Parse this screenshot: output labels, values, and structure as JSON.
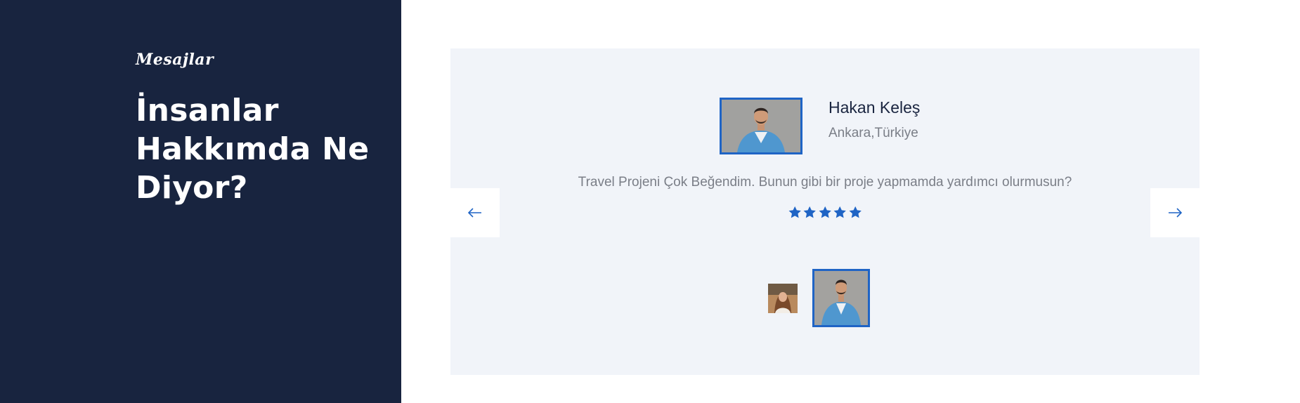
{
  "section": {
    "subtitle": "Mesajlar",
    "headline_line1": "İnsanlar",
    "headline_line2": "Hakkımda Ne",
    "headline_line3": "Diyor?"
  },
  "testimonial": {
    "name": "Hakan Keleş",
    "location": "Ankara,Türkiye",
    "quote": "Travel Projeni Çok Beğendim. Bunun gibi bir proje yapmamda yardımcı olurmusun?",
    "rating": 5,
    "rating_max": 5,
    "star_icon": "star-icon",
    "star_color": "#1f64c5"
  },
  "navigation": {
    "prev_icon": "arrow-left-icon",
    "next_icon": "arrow-right-icon",
    "arrow_color": "#1f64c5"
  },
  "thumbnails": [
    {
      "name": "woman-avatar",
      "active": false
    },
    {
      "name": "man-avatar",
      "active": true
    }
  ],
  "colors": {
    "panel": "#18243f",
    "card": "#f1f4f9",
    "accent": "#1f64c5"
  }
}
